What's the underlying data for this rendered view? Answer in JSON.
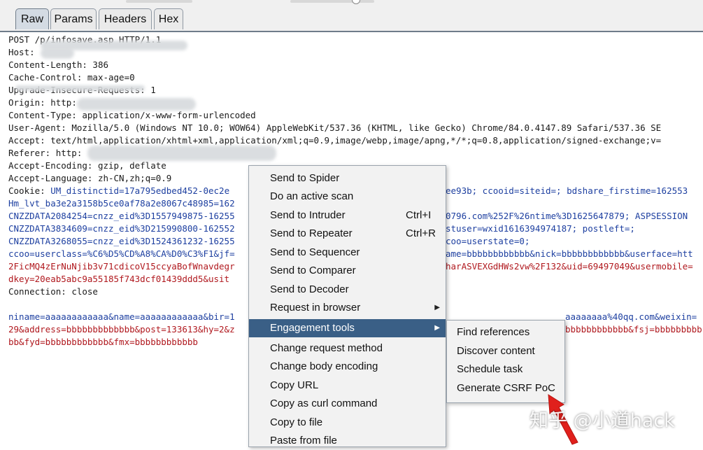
{
  "tabs": [
    {
      "label": "Raw",
      "active": true
    },
    {
      "label": "Params",
      "active": false
    },
    {
      "label": "Headers",
      "active": false
    },
    {
      "label": "Hex",
      "active": false
    }
  ],
  "request_lines": [
    {
      "key": "POST /p/infosave.asp HTTP/1.1",
      "value": ""
    },
    {
      "key": "Host: ",
      "value": ""
    },
    {
      "key": "Content-Length: ",
      "value": "386"
    },
    {
      "key": "Cache-Control: ",
      "value": "max-age=0"
    },
    {
      "key": "Upgrade-Insecure-Requests: ",
      "value": "1"
    },
    {
      "key": "Origin: ",
      "value": "http:"
    },
    {
      "key": "Content-Type: ",
      "value": "application/x-www-form-urlencoded"
    },
    {
      "key": "User-Agent: ",
      "value": "Mozilla/5.0 (Windows NT 10.0; WOW64) AppleWebKit/537.36 (KHTML, like Gecko) Chrome/84.0.4147.89 Safari/537.36 SE"
    },
    {
      "key": "Accept: ",
      "value": "text/html,application/xhtml+xml,application/xml;q=0.9,image/webp,image/apng,*/*;q=0.8,application/signed-exchange;v="
    },
    {
      "key": "Referer: ",
      "value": "http:"
    },
    {
      "key": "Accept-Encoding: ",
      "value": "gzip, deflate"
    },
    {
      "key": "Accept-Language: ",
      "value": "zh-CN,zh;q=0.9"
    }
  ],
  "cookie_label": "Cookie: ",
  "cookie_left": [
    "UM_distinctid=17a795edbed452-0ec2e",
    "Hm_lvt_ba3e2a3158b5ce0af78a2e8067c48985=162",
    "CNZZDATA2084254=cnzz_eid%3D1557949875-16255",
    "CNZZDATA3834609=cnzz_eid%3D215990800-162552",
    "CNZZDATA3268055=cnzz_eid%3D1524361232-16255",
    "ccoo=userclass=%C6%D5%CD%A8%CA%D0%C3%F1&jf=",
    "2FicMQ4zErNuNjib3v71cdicoV15ccyaBofWnavdegr",
    "dkey=20eab5abc9a55185f743dcf01439ddd5&usit"
  ],
  "cookie_right": [
    "ee93b; ccooid=siteid=; bdshare_firstime=162553",
    "",
    "0796.com%252F%26ntime%3D1625647879; ASPSESSION",
    "stuser=wxid1616394974187; postleft=;",
    "coo=userstate=0;",
    "ame=bbbbbbbbbbbb&nick=bbbbbbbbbbbb&userface=htt",
    "harASVEXGdHWs2vw%2F132&uid=69497049&usermobile=",
    ""
  ],
  "connection_key": "Connection: ",
  "connection_value": "close",
  "body_left": [
    "niname=aaaaaaaaaaaa&name=aaaaaaaaaaaa&bir=1",
    "29&address=bbbbbbbbbbbbb&post=133613&hy=2&z",
    "bb&fyd=bbbbbbbbbbbb&fmx=bbbbbbbbbbbb"
  ],
  "body_right": [
    "aaaaaaaa%40qq.com&weixin=",
    "bbbbbbbbbbbb&fsj=bbbbbbbbb",
    ""
  ],
  "context_menu": [
    {
      "label": "Send to Spider",
      "shortcut": "",
      "submenu": false
    },
    {
      "label": "Do an active scan",
      "shortcut": "",
      "submenu": false
    },
    {
      "label": "Send to Intruder",
      "shortcut": "Ctrl+I",
      "submenu": false
    },
    {
      "label": "Send to Repeater",
      "shortcut": "Ctrl+R",
      "submenu": false
    },
    {
      "label": "Send to Sequencer",
      "shortcut": "",
      "submenu": false
    },
    {
      "label": "Send to Comparer",
      "shortcut": "",
      "submenu": false
    },
    {
      "label": "Send to Decoder",
      "shortcut": "",
      "submenu": false
    },
    {
      "label": "Request in browser",
      "shortcut": "",
      "submenu": true
    },
    {
      "label": "Engagement tools",
      "shortcut": "",
      "submenu": true,
      "highlighted": true
    },
    {
      "label": "Change request method",
      "shortcut": "",
      "submenu": false
    },
    {
      "label": "Change body encoding",
      "shortcut": "",
      "submenu": false
    },
    {
      "label": "Copy URL",
      "shortcut": "",
      "submenu": false
    },
    {
      "label": "Copy as curl command",
      "shortcut": "",
      "submenu": false
    },
    {
      "label": "Copy to file",
      "shortcut": "",
      "submenu": false
    },
    {
      "label": "Paste from file",
      "shortcut": "",
      "submenu": false
    }
  ],
  "submenu": [
    {
      "label": "Find references"
    },
    {
      "label": "Discover content"
    },
    {
      "label": "Schedule task"
    },
    {
      "label": "Generate CSRF PoC"
    }
  ],
  "watermark": "知乎 @小道hack",
  "colors": {
    "highlight": "#3a5f86",
    "cookie_key": "#1d3fa0",
    "cookie_value": "#b0181e",
    "annotation_arrow": "#e0201c"
  }
}
